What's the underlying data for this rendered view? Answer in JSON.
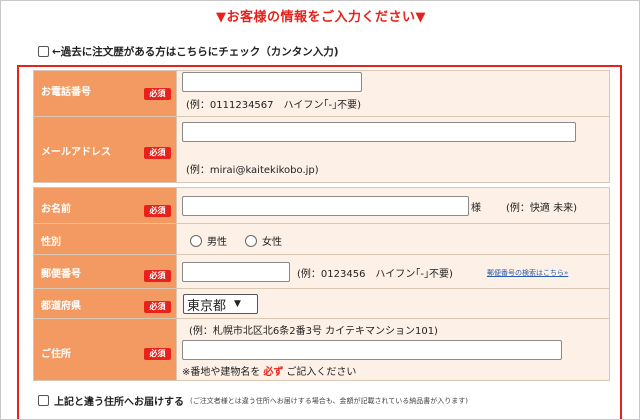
{
  "section_title": "▼お客様の情報をご入力ください▼",
  "past_order": {
    "label": "←過去に注文歴がある方はこちらにチェック（カンタン入力)"
  },
  "required_label": "必須",
  "phone": {
    "label": "お電話番号",
    "value": "",
    "hint": "(例：0111234567　ハイフン｢-｣不要)"
  },
  "email": {
    "label": "メールアドレス",
    "value": "",
    "hint": "(例：mirai@kaitekikobo.jp)"
  },
  "name": {
    "label": "お名前",
    "value": "",
    "suffix": "様",
    "hint": "(例：快適 未来)"
  },
  "gender": {
    "label": "性別",
    "options": [
      "男性",
      "女性"
    ]
  },
  "postal": {
    "label": "郵便番号",
    "value": "",
    "hint": "(例：0123456　ハイフン｢-｣不要)",
    "link": "郵便番号の検索はこちら»"
  },
  "prefecture": {
    "label": "都道府県",
    "selected": "東京都"
  },
  "address": {
    "label": "ご住所",
    "hint": "(例：札幌市北区北6条2番3号 カイテキマンション101)",
    "value": "",
    "note_prefix": "※番地や建物名を",
    "note_emphasis": "必ず",
    "note_suffix": "ご記入ください"
  },
  "different_address": {
    "label": "上記と違う住所へお届けする",
    "note": "(ご注文者様とは違う住所へお届けする場合も、金額が記載されている納品書が入ります)"
  }
}
